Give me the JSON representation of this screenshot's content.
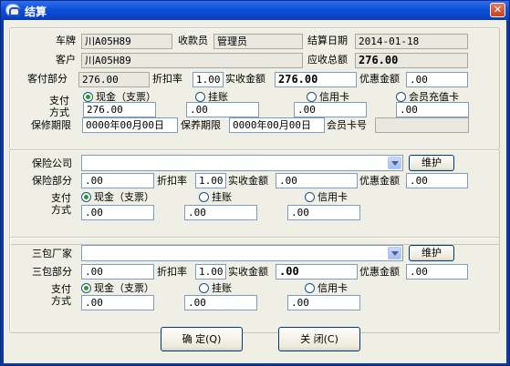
{
  "window": {
    "title": "结算",
    "close_glyph": "✕"
  },
  "top": {
    "plate_label": "车牌",
    "plate_value": "川A05H89",
    "cashier_label": "收款员",
    "cashier_value": "管理员",
    "settle_date_label": "结算日期",
    "settle_date_value": "2014-01-18",
    "customer_label": "客户",
    "customer_value": "川A05H89",
    "total_due_label": "应收总额",
    "total_due_value": "276.00",
    "customer_part_label": "客付部分",
    "customer_part_value": "276.00",
    "discount_label": "折扣率",
    "discount_value": "1.00",
    "received_label": "实收金额",
    "received_value": "276.00",
    "preferential_label": "优惠金额",
    "preferential_value": ".00",
    "pay_label": "支付方式",
    "pay_options": [
      "现金（支票）",
      "挂账",
      "信用卡",
      "会员充值卡"
    ],
    "pay_values": [
      "276.00",
      ".00",
      ".00",
      ".00"
    ],
    "warranty_label": "保修期限",
    "warranty_value": "0000年00月00日",
    "maintain_label": "保养期限",
    "maintain_value": "0000年00月00日",
    "member_card_label": "会员卡号",
    "member_card_value": ""
  },
  "insurance": {
    "company_label": "保险公司",
    "company_value": "",
    "maintain_button": "维护",
    "part_label": "保险部分",
    "part_value": ".00",
    "discount_label": "折扣率",
    "discount_value": "1.00",
    "received_label": "实收金额",
    "received_value": ".00",
    "preferential_label": "优惠金额",
    "preferential_value": ".00",
    "pay_label": "支付方式",
    "pay_options": [
      "现金（支票）",
      "挂账",
      "信用卡"
    ],
    "pay_values": [
      ".00",
      ".00",
      ".00"
    ]
  },
  "warranty_vendor": {
    "vendor_label": "三包厂家",
    "vendor_value": "",
    "maintain_button": "维护",
    "part_label": "三包部分",
    "part_value": ".00",
    "discount_label": "折扣率",
    "discount_value": "1.00",
    "received_label": "实收金额",
    "received_value": ".00",
    "preferential_label": "优惠金额",
    "preferential_value": ".00",
    "pay_label": "支付方式",
    "pay_options": [
      "现金（支票）",
      "挂账",
      "信用卡"
    ],
    "pay_values": [
      ".00",
      ".00",
      ".00"
    ]
  },
  "buttons": {
    "ok": "确 定(Q)",
    "close": "关 闭(C)"
  }
}
